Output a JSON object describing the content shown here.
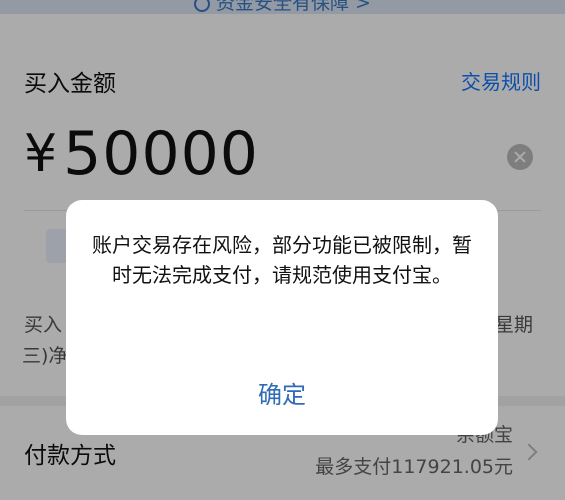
{
  "banner": {
    "text": "资金安全有保障 >"
  },
  "buy": {
    "label": "买入金额",
    "rules_link": "交易规则",
    "currency": "¥",
    "amount": "50000"
  },
  "notes": {
    "line_a": "买入",
    "line_b": "星期",
    "line_c": "三)净"
  },
  "payment": {
    "label": "付款方式",
    "method": "余额宝",
    "limit": "最多支付117921.05元"
  },
  "dialog": {
    "message": "账户交易存在风险，部分功能已被限制，暂时无法完成支付，请规范使用支付宝。",
    "confirm": "确定"
  }
}
